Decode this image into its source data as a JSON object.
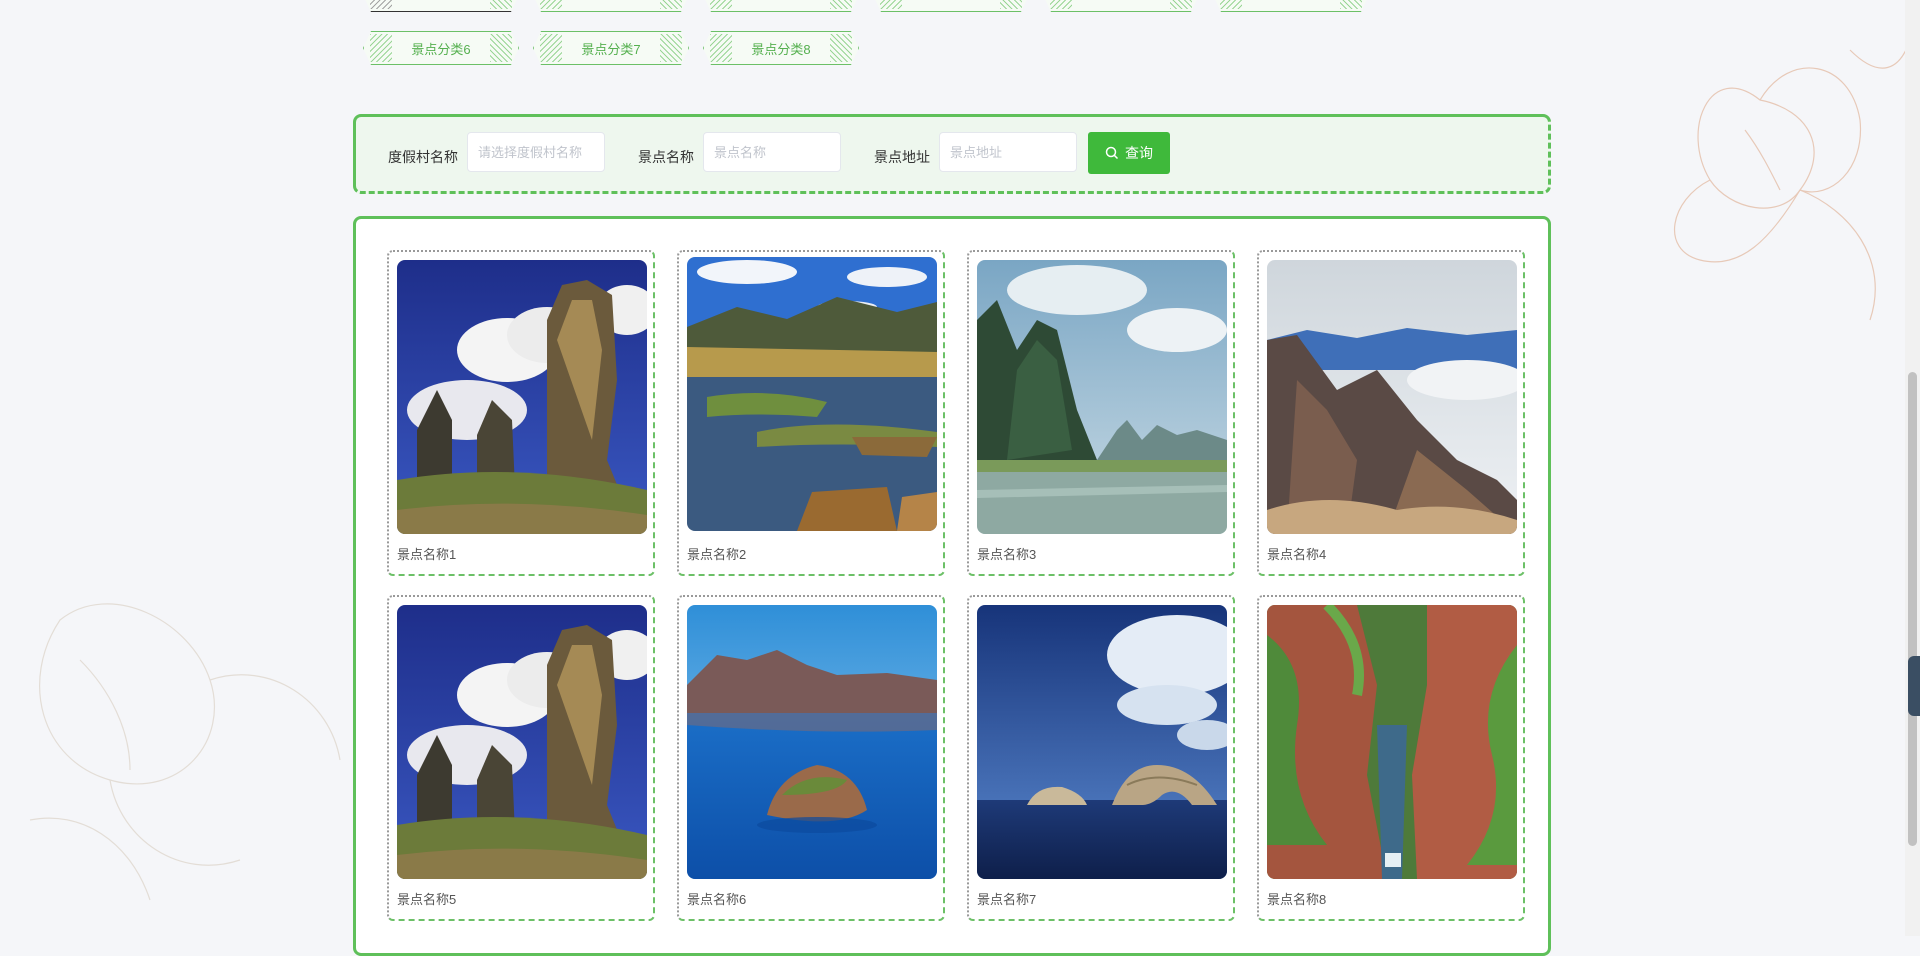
{
  "categories": {
    "row1": [
      "",
      "",
      "",
      "",
      "",
      ""
    ],
    "row2": [
      "景点分类6",
      "景点分类7",
      "景点分类8"
    ]
  },
  "search": {
    "resort_label": "度假村名称",
    "resort_placeholder": "请选择度假村名称",
    "name_label": "景点名称",
    "name_placeholder": "景点名称",
    "address_label": "景点地址",
    "address_placeholder": "景点地址",
    "button_label": "查询",
    "button_color": "#3fb93b"
  },
  "spots": [
    {
      "name": "景点名称1",
      "image": "stone-forest"
    },
    {
      "name": "景点名称2",
      "image": "lake-boat"
    },
    {
      "name": "景点名称3",
      "image": "karst-river"
    },
    {
      "name": "景点名称4",
      "image": "mountain-clouds"
    },
    {
      "name": "景点名称5",
      "image": "stone-forest"
    },
    {
      "name": "景点名称6",
      "image": "lake-island"
    },
    {
      "name": "景点名称7",
      "image": "sea-arch"
    },
    {
      "name": "景点名称8",
      "image": "red-canyon"
    }
  ],
  "theme": {
    "accent": "#5fc05a",
    "background": "#f5f6f9"
  }
}
